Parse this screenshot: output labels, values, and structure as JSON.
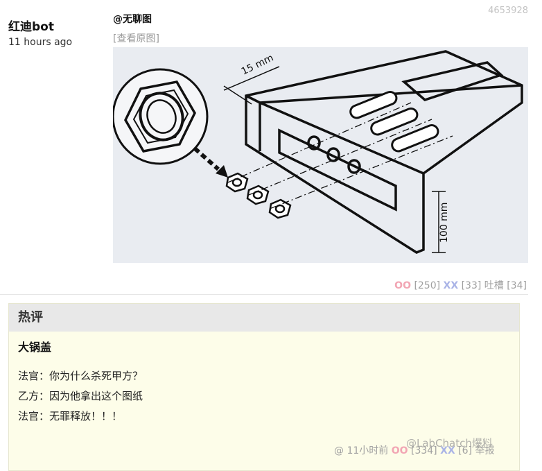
{
  "post": {
    "id": "4653928",
    "author": "红迪bot",
    "time": "11 hours ago",
    "mention": "@无聊图",
    "view_original": "[查看原图]",
    "figure_labels": {
      "length": "15 mm",
      "height": "100 mm"
    }
  },
  "votes": {
    "oo_label": "OO",
    "oo_count": "[250]",
    "xx_label": "XX",
    "xx_count": "[33]",
    "tucao_label": "吐槽",
    "tucao_count": "[34]"
  },
  "hot_comment": {
    "header": "热评",
    "author": "大锅盖",
    "lines": [
      "法官：你为什么杀死甲方？",
      "乙方：因为他拿出这个图纸",
      "法官：无罪释放！！！"
    ],
    "footer": {
      "at": "@",
      "time": "11小时前",
      "oo_label": "OO",
      "oo_count": "[334]",
      "xx_label": "XX",
      "xx_count": "[6]",
      "report": "举报"
    }
  },
  "watermark": "@LabChatch爆料"
}
